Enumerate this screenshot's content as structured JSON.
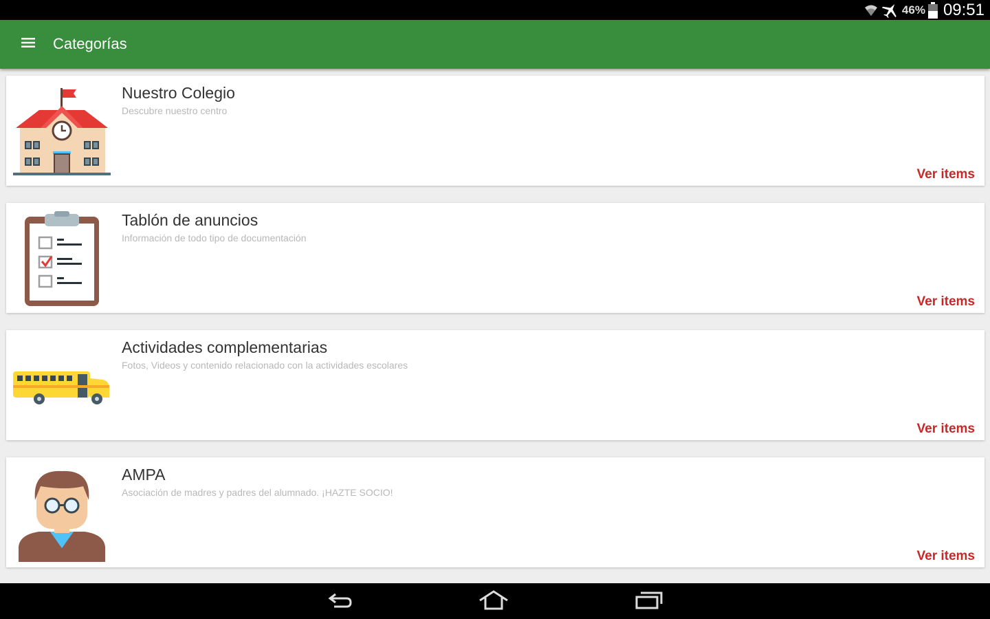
{
  "status_bar": {
    "battery_percent": "46%",
    "time": "09:51",
    "icons": [
      "wifi-icon",
      "airplane-mode-icon",
      "battery-icon"
    ]
  },
  "app_bar": {
    "title": "Categorías",
    "menu_icon": "hamburger-menu-icon",
    "color": "#388e3c"
  },
  "categories": [
    {
      "title": "Nuestro Colegio",
      "subtitle": "Descubre nuestro centro",
      "action": "Ver items",
      "icon": "school-building-icon"
    },
    {
      "title": "Tablón de anuncios",
      "subtitle": "Información de todo tipo de documentación",
      "action": "Ver items",
      "icon": "clipboard-checklist-icon"
    },
    {
      "title": "Actividades complementarias",
      "subtitle": "Fotos, Videos y contenido relacionado con la actividades escolares",
      "action": "Ver items",
      "icon": "school-bus-icon"
    },
    {
      "title": "AMPA",
      "subtitle": "Asociación de madres y padres del alumnado. ¡HAZTE SOCIO!",
      "action": "Ver items",
      "icon": "person-avatar-icon"
    }
  ],
  "nav_bar": {
    "icons": [
      "back-icon",
      "home-icon",
      "recent-apps-icon"
    ]
  },
  "colors": {
    "accent": "#c62828",
    "background": "#eeeeee"
  }
}
